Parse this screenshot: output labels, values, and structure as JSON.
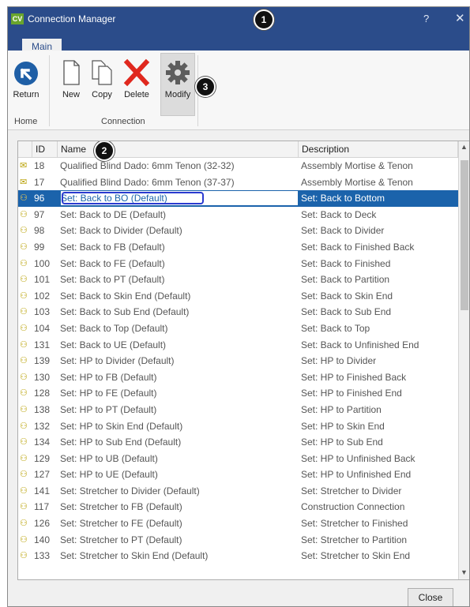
{
  "window": {
    "app_icon": "CV",
    "title": "Connection Manager",
    "help": "?",
    "close": "✕"
  },
  "tabs": {
    "main": "Main"
  },
  "ribbon": {
    "return_label": "Return",
    "new_label": "New",
    "copy_label": "Copy",
    "delete_label": "Delete",
    "modify_label": "Modify",
    "group_home": "Home",
    "group_connection": "Connection"
  },
  "badges": {
    "one": "1",
    "two": "2",
    "three": "3"
  },
  "grid": {
    "col_id": "ID",
    "col_name": "Name",
    "col_desc": "Description",
    "rows": [
      {
        "id": "18",
        "name": "Qualified Blind Dado: 6mm Tenon (32-32)",
        "desc": "Assembly Mortise & Tenon",
        "icon": "✉"
      },
      {
        "id": "17",
        "name": "Qualified Blind Dado: 6mm Tenon (37-37)",
        "desc": "Assembly Mortise & Tenon",
        "icon": "✉"
      },
      {
        "id": "96",
        "name": "Set: Back to BO (Default)",
        "desc": "Set: Back to Bottom",
        "icon": "⚇",
        "selected": true
      },
      {
        "id": "97",
        "name": "Set: Back to DE (Default)",
        "desc": "Set: Back to Deck",
        "icon": "⚇"
      },
      {
        "id": "98",
        "name": "Set: Back to Divider (Default)",
        "desc": "Set: Back to Divider",
        "icon": "⚇"
      },
      {
        "id": "99",
        "name": "Set: Back to FB (Default)",
        "desc": "Set: Back to Finished Back",
        "icon": "⚇"
      },
      {
        "id": "100",
        "name": "Set: Back to FE (Default)",
        "desc": "Set: Back to Finished",
        "icon": "⚇"
      },
      {
        "id": "101",
        "name": "Set: Back to PT (Default)",
        "desc": "Set: Back to Partition",
        "icon": "⚇"
      },
      {
        "id": "102",
        "name": "Set: Back to Skin End (Default)",
        "desc": "Set: Back to Skin End",
        "icon": "⚇"
      },
      {
        "id": "103",
        "name": "Set: Back to Sub End (Default)",
        "desc": "Set: Back to Sub End",
        "icon": "⚇"
      },
      {
        "id": "104",
        "name": "Set: Back to Top (Default)",
        "desc": "Set: Back to Top",
        "icon": "⚇"
      },
      {
        "id": "131",
        "name": "Set: Back to UE (Default)",
        "desc": "Set: Back to Unfinished End",
        "icon": "⚇"
      },
      {
        "id": "139",
        "name": "Set: HP to Divider (Default)",
        "desc": "Set: HP to Divider",
        "icon": "⚇"
      },
      {
        "id": "130",
        "name": "Set: HP to FB (Default)",
        "desc": "Set: HP to Finished Back",
        "icon": "⚇"
      },
      {
        "id": "128",
        "name": "Set: HP to FE (Default)",
        "desc": "Set: HP to Finished End",
        "icon": "⚇"
      },
      {
        "id": "138",
        "name": "Set: HP to PT (Default)",
        "desc": "Set: HP to Partition",
        "icon": "⚇"
      },
      {
        "id": "132",
        "name": "Set: HP to Skin End (Default)",
        "desc": "Set: HP to Skin End",
        "icon": "⚇"
      },
      {
        "id": "134",
        "name": "Set: HP to Sub End (Default)",
        "desc": "Set: HP to Sub End",
        "icon": "⚇"
      },
      {
        "id": "129",
        "name": "Set: HP to UB (Default)",
        "desc": "Set: HP to Unfinished Back",
        "icon": "⚇"
      },
      {
        "id": "127",
        "name": "Set: HP to UE (Default)",
        "desc": "Set: HP to Unfinished End",
        "icon": "⚇"
      },
      {
        "id": "141",
        "name": "Set: Stretcher to Divider (Default)",
        "desc": "Set: Stretcher to Divider",
        "icon": "⚇"
      },
      {
        "id": "117",
        "name": "Set: Stretcher to FB (Default)",
        "desc": "Construction Connection",
        "icon": "⚇"
      },
      {
        "id": "126",
        "name": "Set: Stretcher to FE (Default)",
        "desc": "Set: Stretcher to Finished",
        "icon": "⚇"
      },
      {
        "id": "140",
        "name": "Set: Stretcher to PT (Default)",
        "desc": "Set: Stretcher to Partition",
        "icon": "⚇"
      },
      {
        "id": "133",
        "name": "Set: Stretcher to Skin End (Default)",
        "desc": "Set: Stretcher to Skin End",
        "icon": "⚇"
      }
    ]
  },
  "footer": {
    "close_label": "Close"
  },
  "colors": {
    "titlebar": "#2b4c8a",
    "selection": "#1b63ab",
    "delete_red": "#e0281e",
    "return_blue": "#1f5fa6"
  }
}
